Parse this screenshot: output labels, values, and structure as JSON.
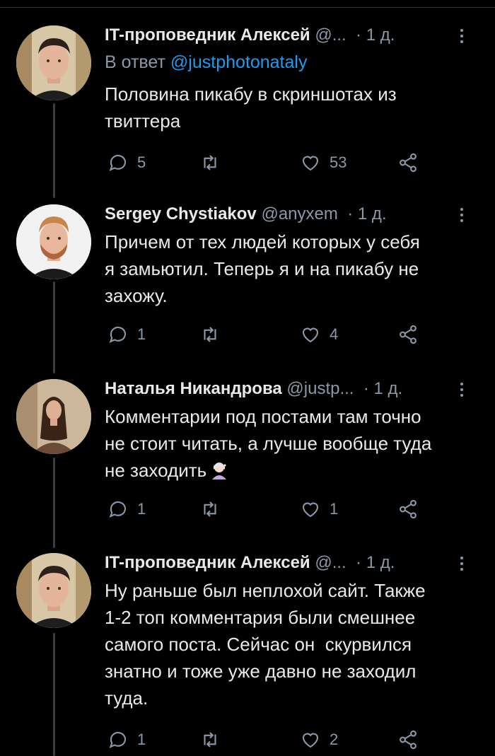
{
  "colors": {
    "background": "#000000",
    "text": "#e7e9ea",
    "secondary": "#8b98a5",
    "link": "#1d9bf0"
  },
  "tweets": [
    {
      "name": "IT-проповедник Алексей",
      "handle": "@...",
      "time": "1 д.",
      "reply_prefix": "В ответ",
      "reply_mention": "@justphotonataly",
      "lines": [
        "Половина пикабу в скриншотах из",
        "твиттера"
      ],
      "replies": "5",
      "retweets": "",
      "likes": "53",
      "avatar": "man-portrait-avatar"
    },
    {
      "name": "Sergey Chystiakov",
      "handle": "@anyxem",
      "time": "1 д.",
      "lines": [
        "Причем от тех людей которых у себя",
        "я замьютил. Теперь я и на пикабу не",
        "захожу."
      ],
      "replies": "1",
      "retweets": "",
      "likes": "4",
      "avatar": "bearded-man-avatar"
    },
    {
      "name": "Наталья Никандрова",
      "handle": "@justp...",
      "time": "1 д.",
      "lines": [
        "Комментарии под постами там точно",
        "не стоит читать, а лучше вообще туда",
        "не заходить"
      ],
      "emoji": "facepalm-emoji",
      "replies": "1",
      "retweets": "",
      "likes": "1",
      "avatar": "woman-portrait-avatar"
    },
    {
      "name": "IT-проповедник Алексей",
      "handle": "@...",
      "time": "1 д.",
      "lines": [
        "Ну раньше был неплохой сайт. Также",
        "1-2 топ комментария были смешнее",
        "самого поста. Сейчас он  скурвился",
        "знатно и тоже уже давно не заходил",
        "туда."
      ],
      "replies": "1",
      "retweets": "",
      "likes": "2",
      "avatar": "man-portrait-avatar"
    }
  ]
}
